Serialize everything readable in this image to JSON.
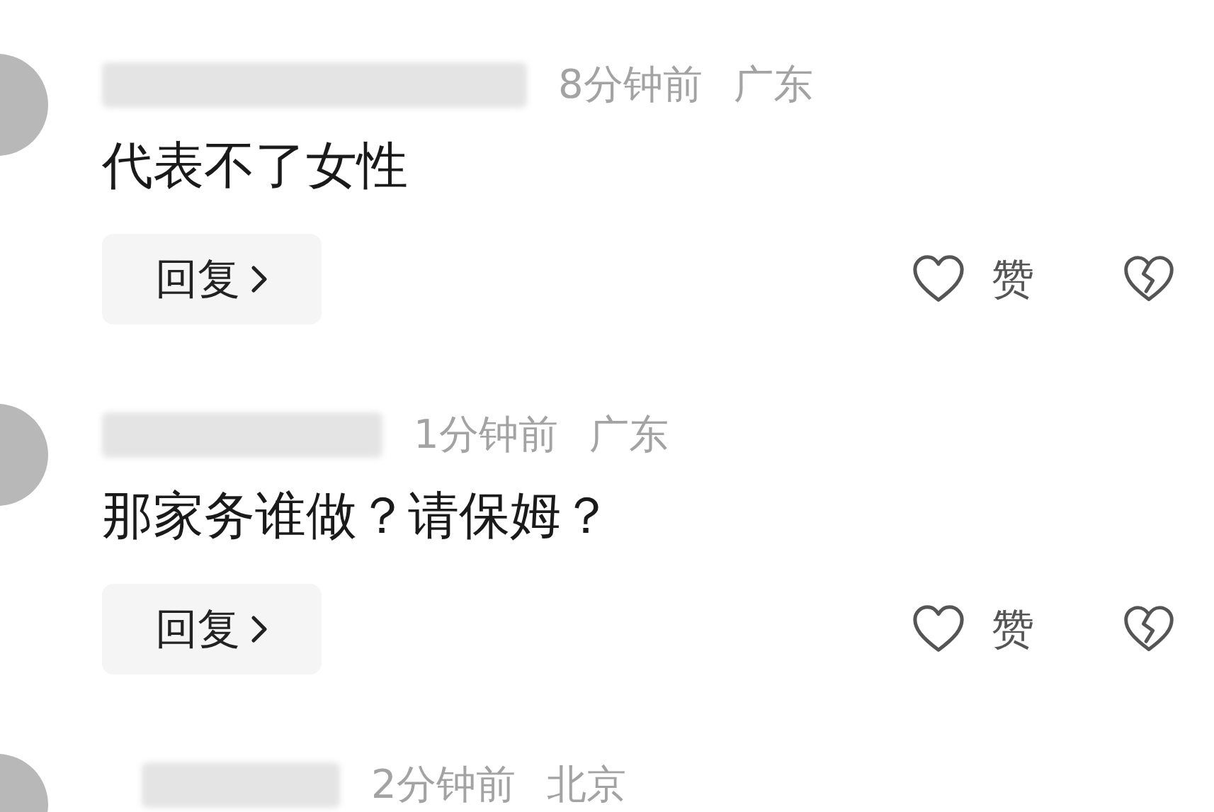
{
  "comments": [
    {
      "time": "8分钟前",
      "location": "广东",
      "content": "代表不了女性",
      "reply_label": "回复",
      "like_label": "赞"
    },
    {
      "time": "1分钟前",
      "location": "广东",
      "content": "那家务谁做？请保姆？",
      "reply_label": "回复",
      "like_label": "赞"
    },
    {
      "time": "2分钟前",
      "location": "北京"
    }
  ]
}
